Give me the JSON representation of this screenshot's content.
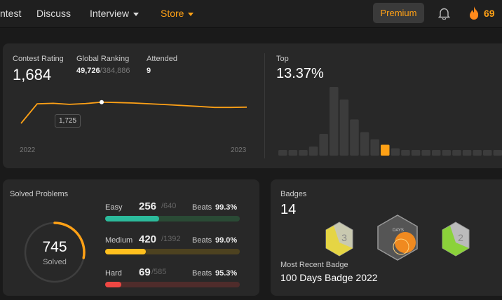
{
  "nav": {
    "items": [
      "ntest",
      "Discuss",
      "Interview",
      "Store"
    ],
    "premium": "Premium",
    "streak": "69"
  },
  "contest": {
    "rating_label": "Contest Rating",
    "rating": "1,684",
    "ranking_label": "Global Ranking",
    "ranking": "49,726",
    "ranking_total": "/384,886",
    "attended_label": "Attended",
    "attended": "9",
    "tooltip": "1,725",
    "x_start": "2022",
    "x_end": "2023"
  },
  "top": {
    "label": "Top",
    "value": "13.37%"
  },
  "chart_data": [
    {
      "type": "line",
      "title": "Contest Rating",
      "x_labels": [
        "2022",
        "2023"
      ],
      "values": [
        1560,
        1712,
        1716,
        1708,
        1714,
        1725,
        1722,
        1718,
        1712,
        1706,
        1699,
        1692,
        1684,
        1684,
        1686
      ],
      "highlight_index": 5,
      "ylim": [
        1500,
        1800
      ]
    },
    {
      "type": "bar",
      "title": "Top",
      "values": [
        3,
        3,
        3,
        5,
        12,
        38,
        31,
        20,
        13,
        9,
        6,
        4,
        3,
        3,
        3,
        3,
        3,
        3,
        3,
        3,
        3,
        3
      ],
      "highlight_index": 10
    }
  ],
  "solved": {
    "label": "Solved Problems",
    "total": "745",
    "sub": "Solved",
    "fraction": 0.28,
    "rows": [
      {
        "name": "Easy",
        "count": "256",
        "total": "/640",
        "beats_label": "Beats",
        "beats": "99.3%",
        "pct": 0.4,
        "fg": "#2cbb9c",
        "bg": "#2a4a35"
      },
      {
        "name": "Medium",
        "count": "420",
        "total": "/1392",
        "beats_label": "Beats",
        "beats": "99.0%",
        "pct": 0.3,
        "fg": "#ffc01e",
        "bg": "#4d4220"
      },
      {
        "name": "Hard",
        "count": "69",
        "total": "/585",
        "beats_label": "Beats",
        "beats": "95.3%",
        "pct": 0.12,
        "fg": "#ef4743",
        "bg": "#4f2c2b"
      }
    ]
  },
  "badges": {
    "label": "Badges",
    "count": "14",
    "recent_label": "Most Recent Badge",
    "recent": "100 Days Badge 2022",
    "badge_texts": [
      "3",
      "DAYS",
      "2"
    ]
  }
}
